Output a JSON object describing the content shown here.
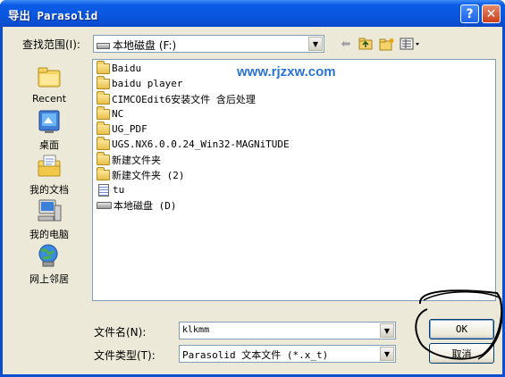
{
  "window": {
    "title": "导出 Parasolid",
    "help_glyph": "?",
    "close_glyph": "✕"
  },
  "lookin": {
    "label": "查找范围(I):",
    "value": "本地磁盘 (F:)"
  },
  "toolbar": {
    "back_icon": "back-arrow-icon",
    "up_icon": "up-folder-icon",
    "new_folder_icon": "new-folder-icon",
    "view_icon": "view-menu-icon"
  },
  "places": [
    {
      "label": "Recent",
      "icon": "recent-icon"
    },
    {
      "label": "桌面",
      "icon": "desktop-icon"
    },
    {
      "label": "我的文档",
      "icon": "my-documents-icon"
    },
    {
      "label": "我的电脑",
      "icon": "my-computer-icon"
    },
    {
      "label": "网上邻居",
      "icon": "network-icon"
    }
  ],
  "files": [
    {
      "name": "Baidu",
      "type": "folder"
    },
    {
      "name": "baidu player",
      "type": "folder"
    },
    {
      "name": "CIMCOEdit6安装文件 含后处理",
      "type": "folder"
    },
    {
      "name": "NC",
      "type": "folder"
    },
    {
      "name": "UG_PDF",
      "type": "folder"
    },
    {
      "name": "UGS.NX6.0.0.24_Win32-MAGNiTUDE",
      "type": "folder"
    },
    {
      "name": "新建文件夹",
      "type": "folder"
    },
    {
      "name": "新建文件夹 (2)",
      "type": "folder"
    },
    {
      "name": "tu",
      "type": "document"
    },
    {
      "name": "本地磁盘 (D)",
      "type": "drive"
    }
  ],
  "watermark": "www.rjzxw.com",
  "filename": {
    "label": "文件名(N):",
    "value": "klkmm"
  },
  "filetype": {
    "label": "文件类型(T):",
    "value": "Parasolid 文本文件 (*.x_t)"
  },
  "buttons": {
    "ok": "OK",
    "cancel": "取消"
  },
  "colors": {
    "titlebar": "#0a56de",
    "client": "#ece9d8",
    "watermark": "#2a73d6"
  }
}
